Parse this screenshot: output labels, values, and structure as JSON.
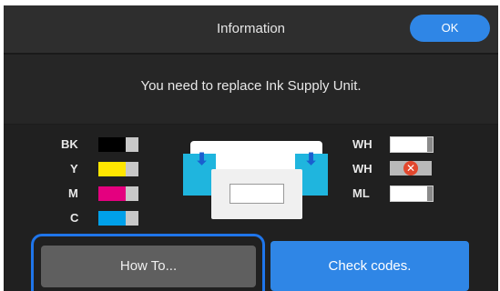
{
  "dialog": {
    "title": "Information",
    "ok_label": "OK",
    "message": "You need to replace Ink Supply Unit."
  },
  "ink_left": [
    {
      "label": "BK",
      "color": "#000000"
    },
    {
      "label": "Y",
      "color": "#ffe600"
    },
    {
      "label": "M",
      "color": "#e4007f"
    },
    {
      "label": "C",
      "color": "#00a0e9"
    }
  ],
  "ink_right": [
    {
      "label": "WH",
      "status": "ok"
    },
    {
      "label": "WH",
      "status": "error"
    },
    {
      "label": "ML",
      "status": "ok"
    }
  ],
  "buttons": {
    "how_to": "How To...",
    "check_codes": "Check codes."
  },
  "colors": {
    "accent": "#2f86e6",
    "background": "#262626",
    "error": "#e2472d"
  }
}
